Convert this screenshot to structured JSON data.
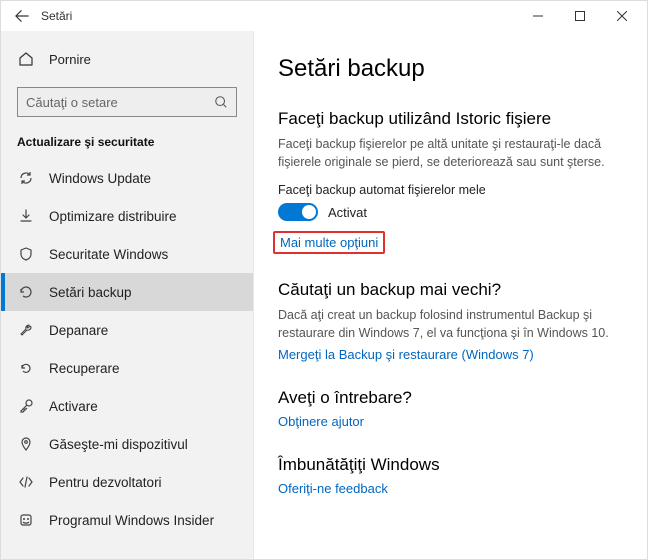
{
  "titlebar": {
    "title": "Setări"
  },
  "sidebar": {
    "home_label": "Pornire",
    "search_placeholder": "Căutaţi o setare",
    "group_header": "Actualizare şi securitate",
    "items": [
      {
        "label": "Windows Update"
      },
      {
        "label": "Optimizare distribuire"
      },
      {
        "label": "Securitate Windows"
      },
      {
        "label": "Setări backup"
      },
      {
        "label": "Depanare"
      },
      {
        "label": "Recuperare"
      },
      {
        "label": "Activare"
      },
      {
        "label": "Găseşte-mi dispozitivul"
      },
      {
        "label": "Pentru dezvoltatori"
      },
      {
        "label": "Programul Windows Insider"
      }
    ]
  },
  "main": {
    "page_title": "Setări backup",
    "history": {
      "heading": "Faceţi backup utilizând Istoric fişiere",
      "desc": "Faceţi backup fişierelor pe altă unitate şi restauraţi-le dacă fişierele originale se pierd, se deteriorează sau sunt şterse.",
      "toggle_label": "Faceţi backup automat fişierelor mele",
      "toggle_state": "Activat",
      "more_link": "Mai multe opţiuni"
    },
    "older": {
      "heading": "Căutaţi un backup mai vechi?",
      "desc": "Dacă aţi creat un backup folosind instrumentul Backup şi restaurare din Windows 7, el va funcţiona şi în Windows 10.",
      "link": "Mergeţi la Backup şi restaurare (Windows 7)"
    },
    "question": {
      "heading": "Aveţi o întrebare?",
      "link": "Obţinere ajutor"
    },
    "improve": {
      "heading": "Îmbunătăţiţi Windows",
      "link": "Oferiţi-ne feedback"
    }
  }
}
